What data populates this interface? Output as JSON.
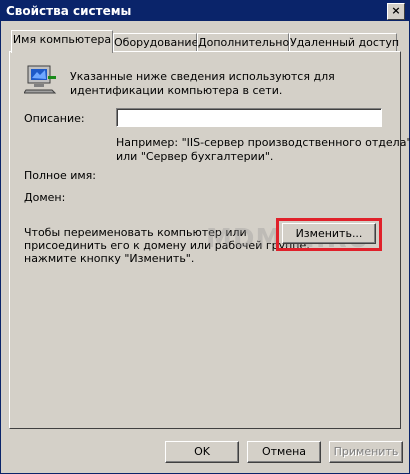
{
  "window": {
    "title": "Свойства системы",
    "close": "×"
  },
  "tabs": [
    {
      "label": "Имя компьютера",
      "active": true
    },
    {
      "label": "Оборудование",
      "active": false
    },
    {
      "label": "Дополнительно",
      "active": false
    },
    {
      "label": "Удаленный доступ",
      "active": false
    }
  ],
  "info": {
    "icon": "computer-icon",
    "text_line1": "Указанные ниже сведения используются для",
    "text_line2": "идентификации компьютера в сети."
  },
  "description": {
    "label": "Описание:",
    "value": "",
    "example_line1": "Например: \"IIS-сервер производственного отдела\"",
    "example_line2": "или \"Сервер бухгалтерии\"."
  },
  "full_name_label": "Полное имя:",
  "domain_label": "Домен:",
  "rename": {
    "text_line1": "Чтобы переименовать компьютер или",
    "text_line2": "присоединить его к домену или рабочей группе,",
    "text_line3": "нажмите кнопку \"Изменить\".",
    "button": "Изменить...",
    "highlight_color": "#e0202a"
  },
  "watermark": "MDMIN.RU",
  "footer": {
    "ok": "OK",
    "cancel": "Отмена",
    "apply": "Применить"
  }
}
